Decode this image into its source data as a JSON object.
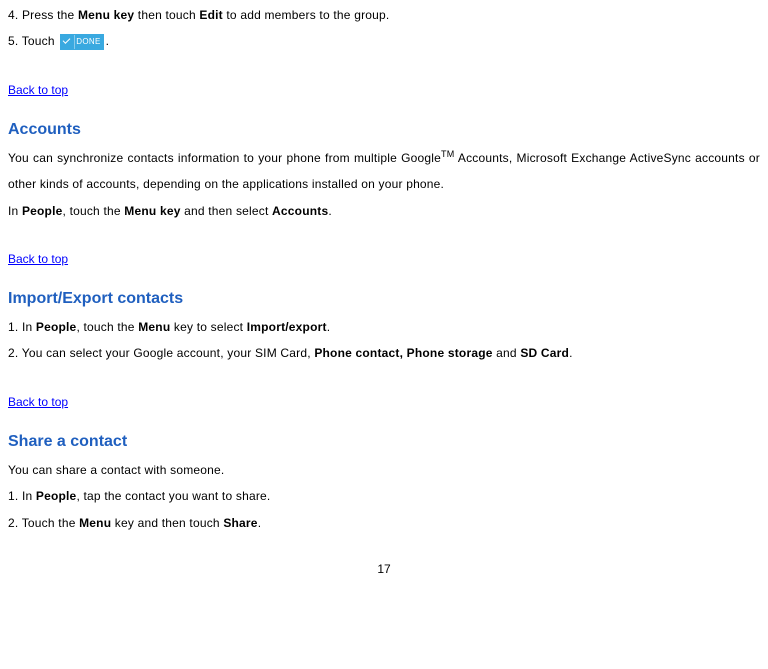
{
  "step4_part1": "4. Press the ",
  "step4_bold1": "Menu key",
  "step4_part2": " then touch ",
  "step4_bold2": "Edit",
  "step4_part3": " to add members to the group.",
  "step5_part1": "5. Touch  ",
  "done_label": "DONE",
  "step5_part2": ".",
  "back_to_top": "Back to top",
  "accounts": {
    "heading": "Accounts",
    "p1_a": "You  can  synchronize  contacts  information  to  your  phone  from  multiple  Google",
    "tm": "TM",
    "p1_b": "  Accounts,  Microsoft  Exchange ActiveSync accounts or other kinds of accounts, depending on the applications installed on your phone.",
    "p2_a": "In ",
    "p2_bold1": "People",
    "p2_b": ", touch the ",
    "p2_bold2": "Menu key",
    "p2_c": " and then select ",
    "p2_bold3": "Accounts",
    "p2_d": "."
  },
  "import": {
    "heading": "Import/Export contacts",
    "s1_a": "1. In ",
    "s1_bold1": "People",
    "s1_b": ", touch the ",
    "s1_bold2": "Menu",
    "s1_c": " key to select ",
    "s1_bold3": "Import/export",
    "s1_d": ".",
    "s2_a": "2. You can select your Google account, your SIM Card, ",
    "s2_bold1": "Phone contact, Phone storage",
    "s2_b": " and ",
    "s2_bold2": "SD Card",
    "s2_c": "."
  },
  "share": {
    "heading": "Share a contact",
    "p1": "You can share a contact with someone.",
    "s1_a": "1. In ",
    "s1_bold1": "People",
    "s1_b": ", tap the contact you want to share.",
    "s2_a": "2. Touch the ",
    "s2_bold1": "Menu",
    "s2_b": " key and then touch ",
    "s2_bold2": "Share",
    "s2_c": "."
  },
  "page_number": "17"
}
